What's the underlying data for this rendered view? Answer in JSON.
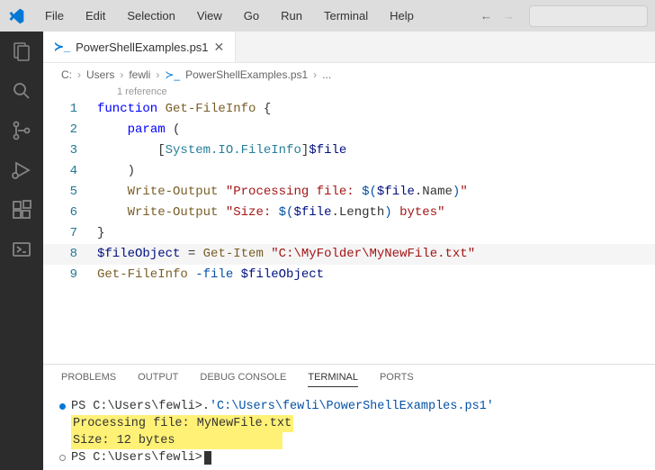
{
  "menu": {
    "file": "File",
    "edit": "Edit",
    "selection": "Selection",
    "view": "View",
    "go": "Go",
    "run": "Run",
    "terminal": "Terminal",
    "help": "Help"
  },
  "tab": {
    "name": "PowerShellExamples.ps1"
  },
  "breadcrumb": {
    "c": "C:",
    "users": "Users",
    "fewli": "fewli",
    "file": "PowerShellExamples.ps1",
    "more": "..."
  },
  "codelens": "1 reference",
  "lines": {
    "1": "1",
    "2": "2",
    "3": "3",
    "4": "4",
    "5": "5",
    "6": "6",
    "7": "7",
    "8": "8",
    "9": "9"
  },
  "code": {
    "l1_function": "function",
    "l1_name": " Get-FileInfo ",
    "l1_brace": "{",
    "l2_param": "param",
    "l2_paren": " (",
    "l3_indent": "        [",
    "l3_type": "System.IO.FileInfo",
    "l3_close": "]",
    "l3_var": "$file",
    "l4_close": "    )",
    "l5_cmd": "Write-Output",
    "l5_str1": " \"Processing file: ",
    "l5_sub1": "$(",
    "l5_var": "$file",
    "l5_prop": ".Name",
    "l5_sub2": ")",
    "l5_str2": "\"",
    "l6_cmd": "Write-Output",
    "l6_str1": " \"Size: ",
    "l6_sub1": "$(",
    "l6_var": "$file",
    "l6_prop": ".Length",
    "l6_sub2": ")",
    "l6_str2": " bytes\"",
    "l7_brace": "}",
    "l8_var": "$fileObject",
    "l8_eq": " = ",
    "l8_cmd": "Get-Item",
    "l8_str": " \"C:\\MyFolder\\MyNewFile.txt\"",
    "l9_cmd": "Get-FileInfo",
    "l9_param": " -file ",
    "l9_var": "$fileObject"
  },
  "panel": {
    "problems": "PROBLEMS",
    "output": "OUTPUT",
    "debug": "DEBUG CONSOLE",
    "terminal": "TERMINAL",
    "ports": "PORTS"
  },
  "term": {
    "prompt1": "PS C:\\Users\\fewli> ",
    "cmd1_dot": ". ",
    "cmd1_path": "'C:\\Users\\fewli\\PowerShellExamples.ps1'",
    "out1": "Processing file: MyNewFile.txt",
    "out2": "Size: 12 bytes",
    "prompt2": "PS C:\\Users\\fewli> "
  }
}
